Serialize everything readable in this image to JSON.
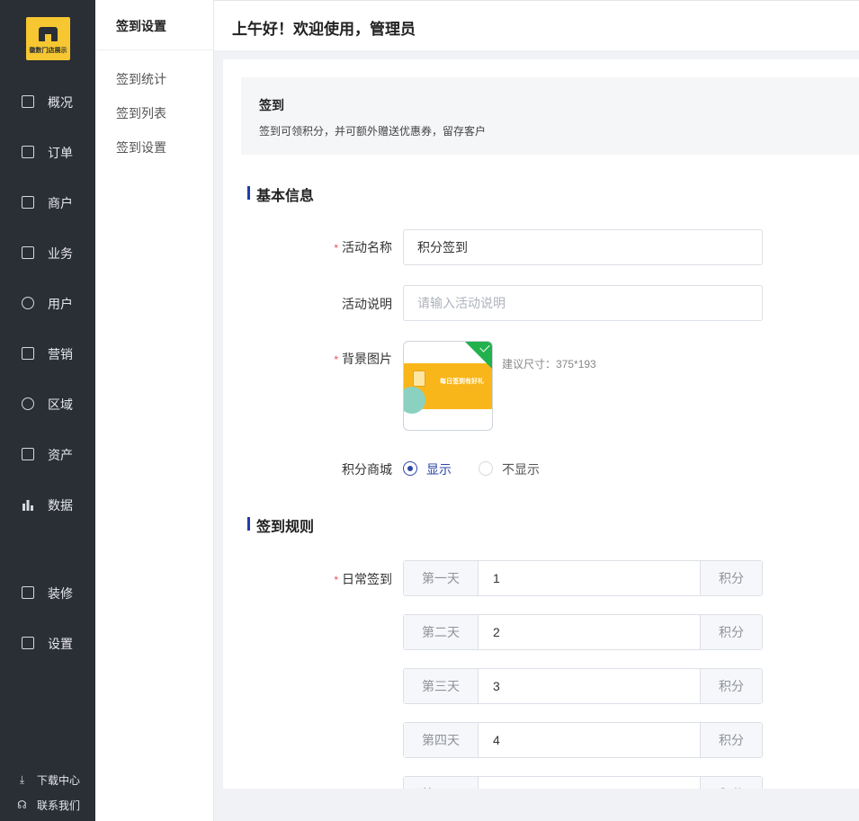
{
  "brand": {
    "logo_text": "徽数门店展示"
  },
  "sidebar": {
    "items": [
      {
        "label": "概况",
        "icon": "chart-icon"
      },
      {
        "label": "订单",
        "icon": "document-icon"
      },
      {
        "label": "商户",
        "icon": "building-icon"
      },
      {
        "label": "业务",
        "icon": "briefcase-icon"
      },
      {
        "label": "用户",
        "icon": "user-icon"
      },
      {
        "label": "营销",
        "icon": "tag-icon"
      },
      {
        "label": "区域",
        "icon": "database-icon"
      },
      {
        "label": "资产",
        "icon": "wallet-icon"
      },
      {
        "label": "数据",
        "icon": "bar-chart-icon"
      },
      {
        "label": "装修",
        "icon": "shop-icon"
      },
      {
        "label": "设置",
        "icon": "tablet-icon"
      }
    ],
    "bottom": [
      {
        "label": "下载中心",
        "icon": "download-icon"
      },
      {
        "label": "联系我们",
        "icon": "headset-icon"
      }
    ]
  },
  "subnav": {
    "title": "签到设置",
    "items": [
      "签到统计",
      "签到列表",
      "签到设置"
    ]
  },
  "header": {
    "greeting": "上午好！欢迎使用，管理员"
  },
  "notice": {
    "title": "签到",
    "desc": "签到可领积分，并可额外赠送优惠券，留存客户"
  },
  "sections": {
    "basic": "基本信息",
    "rules": "签到规则"
  },
  "form": {
    "required_mark": "*",
    "name_label": "活动名称",
    "name_value": "积分签到",
    "desc_label": "活动说明",
    "desc_placeholder": "请输入活动说明",
    "bg_label": "背景图片",
    "bg_banner_text": "每日签到有好礼",
    "bg_hint": "建议尺寸：375*193",
    "mall_label": "积分商城",
    "mall_options": [
      "显示",
      "不显示"
    ],
    "mall_selected": "显示",
    "daily_label": "日常签到",
    "suffix": "积分",
    "days": [
      {
        "day": "第一天",
        "points": "1"
      },
      {
        "day": "第二天",
        "points": "2"
      },
      {
        "day": "第三天",
        "points": "3"
      },
      {
        "day": "第四天",
        "points": "4"
      },
      {
        "day": "第五天",
        "points": ""
      }
    ]
  },
  "colors": {
    "sidebar_bg": "#2a2e35",
    "accent": "#1f3ea8",
    "logo_bg": "#f7c731",
    "required": "#e94f4f"
  }
}
